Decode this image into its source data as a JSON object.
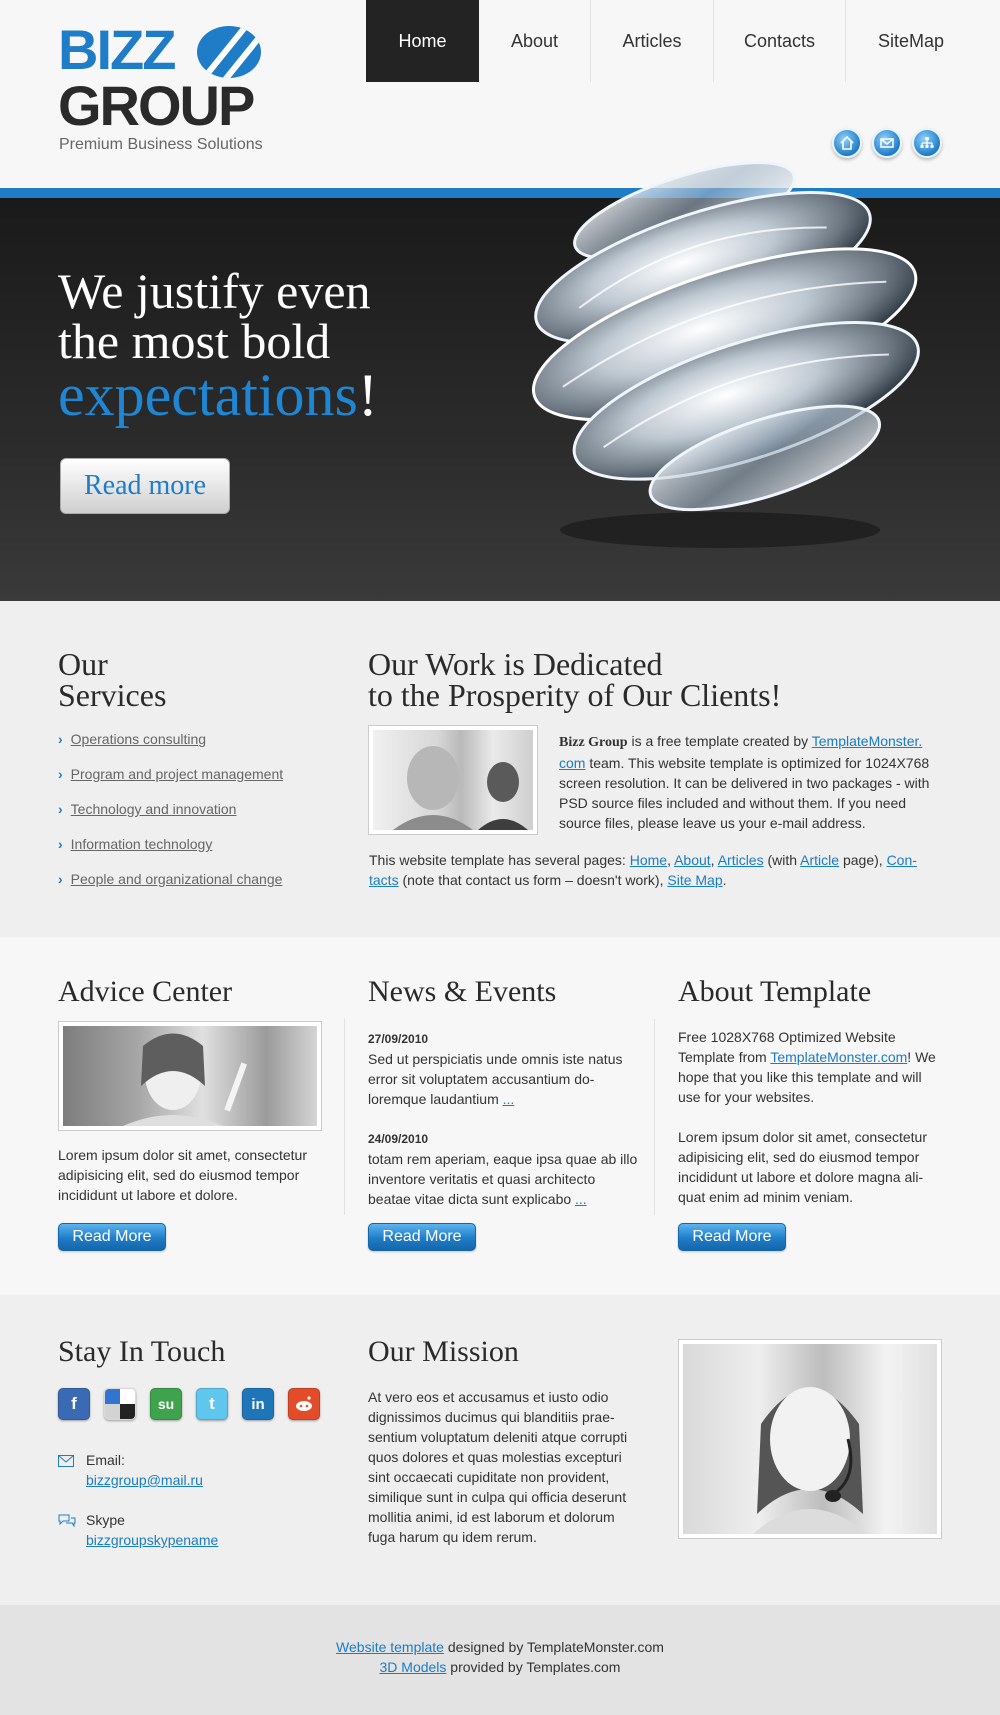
{
  "logo": {
    "line1": "BIZZ",
    "line2": "GROUP",
    "tagline": "Premium Business Solutions"
  },
  "nav": {
    "items": [
      {
        "label": "Home"
      },
      {
        "label": "About"
      },
      {
        "label": "Articles"
      },
      {
        "label": "Contacts"
      },
      {
        "label": "SiteMap"
      }
    ],
    "active": "Home"
  },
  "header_icons": [
    "home-icon",
    "mail-icon",
    "sitemap-icon"
  ],
  "hero": {
    "line1": "We justify even",
    "line2": "the most bold",
    "line3": "expectations",
    "excl": "!",
    "button": "Read more"
  },
  "services": {
    "title_line1": "Our",
    "title_line2": "Services",
    "items": [
      "Operations consulting",
      "Program and project management",
      "Technology and innovation",
      "Information technology",
      "People and organizational change"
    ]
  },
  "work": {
    "title_line1": "Our Work is Dedicated",
    "title_line2": "to the Prosperity of Our Clients!",
    "brand": "Bizz Group",
    "p1_a": " is a free template created by ",
    "p1_link_a": "TemplateMonster.",
    "p1_link_b": "com",
    "p1_b": " team. This website template is optimized for 1024X768 screen resolution. It can be delivered in two packages - with PSD source files included and without them. If you need source files, please leave us your e-mail address.",
    "p2_a": "This website template has several pages: ",
    "p2_home": "Home",
    "p2_about": "About",
    "p2_articles": "Articles",
    "p2_with": " (with ",
    "p2_article": "Article",
    "p2_page": " page), ",
    "p2_contacts_a": "Con-",
    "p2_contacts_b": "tacts",
    "p2_note": " (note that contact us form – doesn't work), ",
    "p2_sitemap": "Site Map",
    "p2_end": "."
  },
  "advice": {
    "title": "Advice Center",
    "text": "Lorem ipsum dolor sit amet, consectetur adipisicing elit, sed do eiusmod tempor incididunt ut labore et dolore.",
    "button": "Read More"
  },
  "news": {
    "title": "News & Events",
    "items": [
      {
        "date": "27/09/2010",
        "text": "Sed ut perspiciatis unde omnis iste natus error sit voluptatem accusantium do-loremque laudantium",
        "more": "..."
      },
      {
        "date": "24/09/2010",
        "text": "totam rem aperiam, eaque ipsa quae ab illo inventore veritatis et quasi architecto beatae vitae dicta sunt explicabo",
        "more": "..."
      }
    ],
    "button": "Read More"
  },
  "about_template": {
    "title": "About Template",
    "p1_a": "Free 1028X768 Optimized Website Template from ",
    "p1_link": "TemplateMonster.com",
    "p1_b": "! We hope that you like this template and will use for your websites.",
    "p2": "Lorem ipsum dolor sit amet, consectetur adipisicing elit, sed do eiusmod tempor incididunt ut labore et dolore magna ali-quat enim ad minim veniam.",
    "button": "Read More"
  },
  "touch": {
    "title": "Stay In Touch",
    "social": [
      {
        "name": "facebook-icon",
        "glyph": "f",
        "color": "#3b6ab5"
      },
      {
        "name": "delicious-icon",
        "glyph": "",
        "color": "#ffffff"
      },
      {
        "name": "stumbleupon-icon",
        "glyph": "su",
        "color": "#3fa34d"
      },
      {
        "name": "twitter-icon",
        "glyph": "t",
        "color": "#5fc6ee"
      },
      {
        "name": "linkedin-icon",
        "glyph": "in",
        "color": "#1e76b9"
      },
      {
        "name": "reddit-icon",
        "glyph": "●",
        "color": "#e24c2a"
      }
    ],
    "email_label": "Email:",
    "email_value": "bizzgroup@mail.ru",
    "skype_label": "Skype",
    "skype_value": "bizzgroupskypename"
  },
  "mission": {
    "title": "Our Mission",
    "text": "At vero eos et accusamus et iusto odio dignissimos ducimus qui blanditiis prae-sentium voluptatum deleniti atque corrupti quos dolores et quas molestias excepturi sint occaecati cupiditate non provident, similique sunt in culpa qui officia deserunt mollitia animi, id est laborum et dolorum fuga harum qu idem rerum."
  },
  "footer": {
    "l1_link": "Website template",
    "l1_text": " designed by TemplateMonster.com",
    "l2_link": "3D Models",
    "l2_text": " provided by Templates.com"
  },
  "colors": {
    "accent": "#1f7cc7",
    "dark": "#232323"
  }
}
